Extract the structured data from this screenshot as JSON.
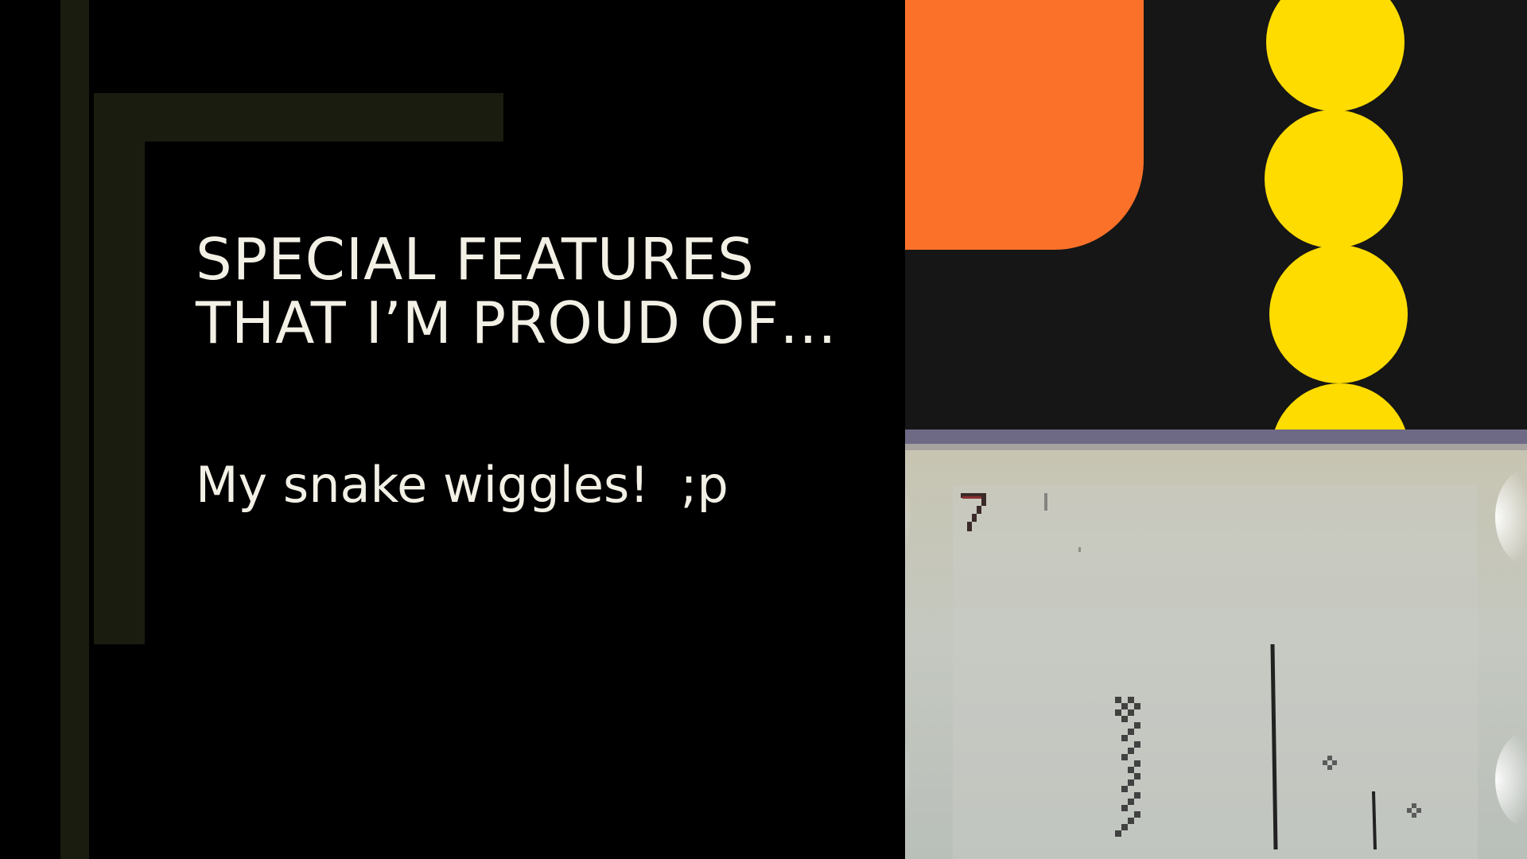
{
  "slide": {
    "title_lines": [
      "SPECIAL FEATURES",
      "THAT I’M PROUD OF…"
    ],
    "body": "My snake wiggles!  ;p"
  },
  "colors": {
    "background": "#000000",
    "accent_bar": "#1b1c10",
    "text": "#f3f0e6",
    "art_background": "#161616",
    "orange": "#fc7129",
    "yellow": "#fedc00"
  },
  "video": {
    "score_display": "7",
    "description": "photo of an Etch A Sketch style drawing screen"
  }
}
